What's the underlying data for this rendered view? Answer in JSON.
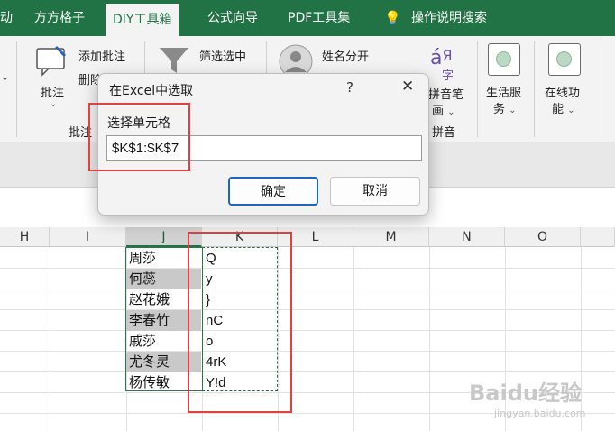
{
  "ribbon": {
    "tabs": [
      "动",
      "方方格子",
      "DIY工具箱",
      "公式向导",
      "PDF工具集",
      "操作说明搜索"
    ],
    "active_tab": "DIY工具箱",
    "groups": {
      "comment": {
        "add": "添加批注",
        "delete": "删除",
        "big": "批注",
        "label": "批注"
      },
      "filter": {
        "label": "筛选选中"
      },
      "name": {
        "label": "姓名分开"
      },
      "pinyin": {
        "big1": "拼音笔",
        "big2": "画",
        "label": "拼音",
        "glyph": "á",
        "glyph2": "Я",
        "glyph3": "字"
      },
      "life": {
        "line1": "生活服",
        "line2": "务"
      },
      "online": {
        "line1": "在线功",
        "line2": "能"
      }
    }
  },
  "dialog": {
    "title": "在Excel中选取",
    "help": "?",
    "close": "✕",
    "field_label": "选择单元格",
    "field_value": "$K$1:$K$7",
    "ok": "确定",
    "cancel": "取消"
  },
  "columns": [
    "H",
    "I",
    "J",
    "K",
    "L",
    "M",
    "N",
    "O"
  ],
  "selected_column": "J",
  "rows": [
    {
      "j": "周莎",
      "k": "Q"
    },
    {
      "j": "何蕊",
      "k": "y"
    },
    {
      "j": "赵花娥",
      "k": "}"
    },
    {
      "j": "李春竹",
      "k": "nC"
    },
    {
      "j": "戚莎",
      "k": "o"
    },
    {
      "j": "尤冬灵",
      "k": "4rK"
    },
    {
      "j": "杨传敏",
      "k": "Y!d"
    }
  ],
  "watermark": {
    "brand": "Baidu经验",
    "url": "jingyan.baidu.com"
  },
  "colors": {
    "excel_green": "#217346",
    "annotation_red": "#e34040",
    "ok_border": "#1e65c4"
  }
}
